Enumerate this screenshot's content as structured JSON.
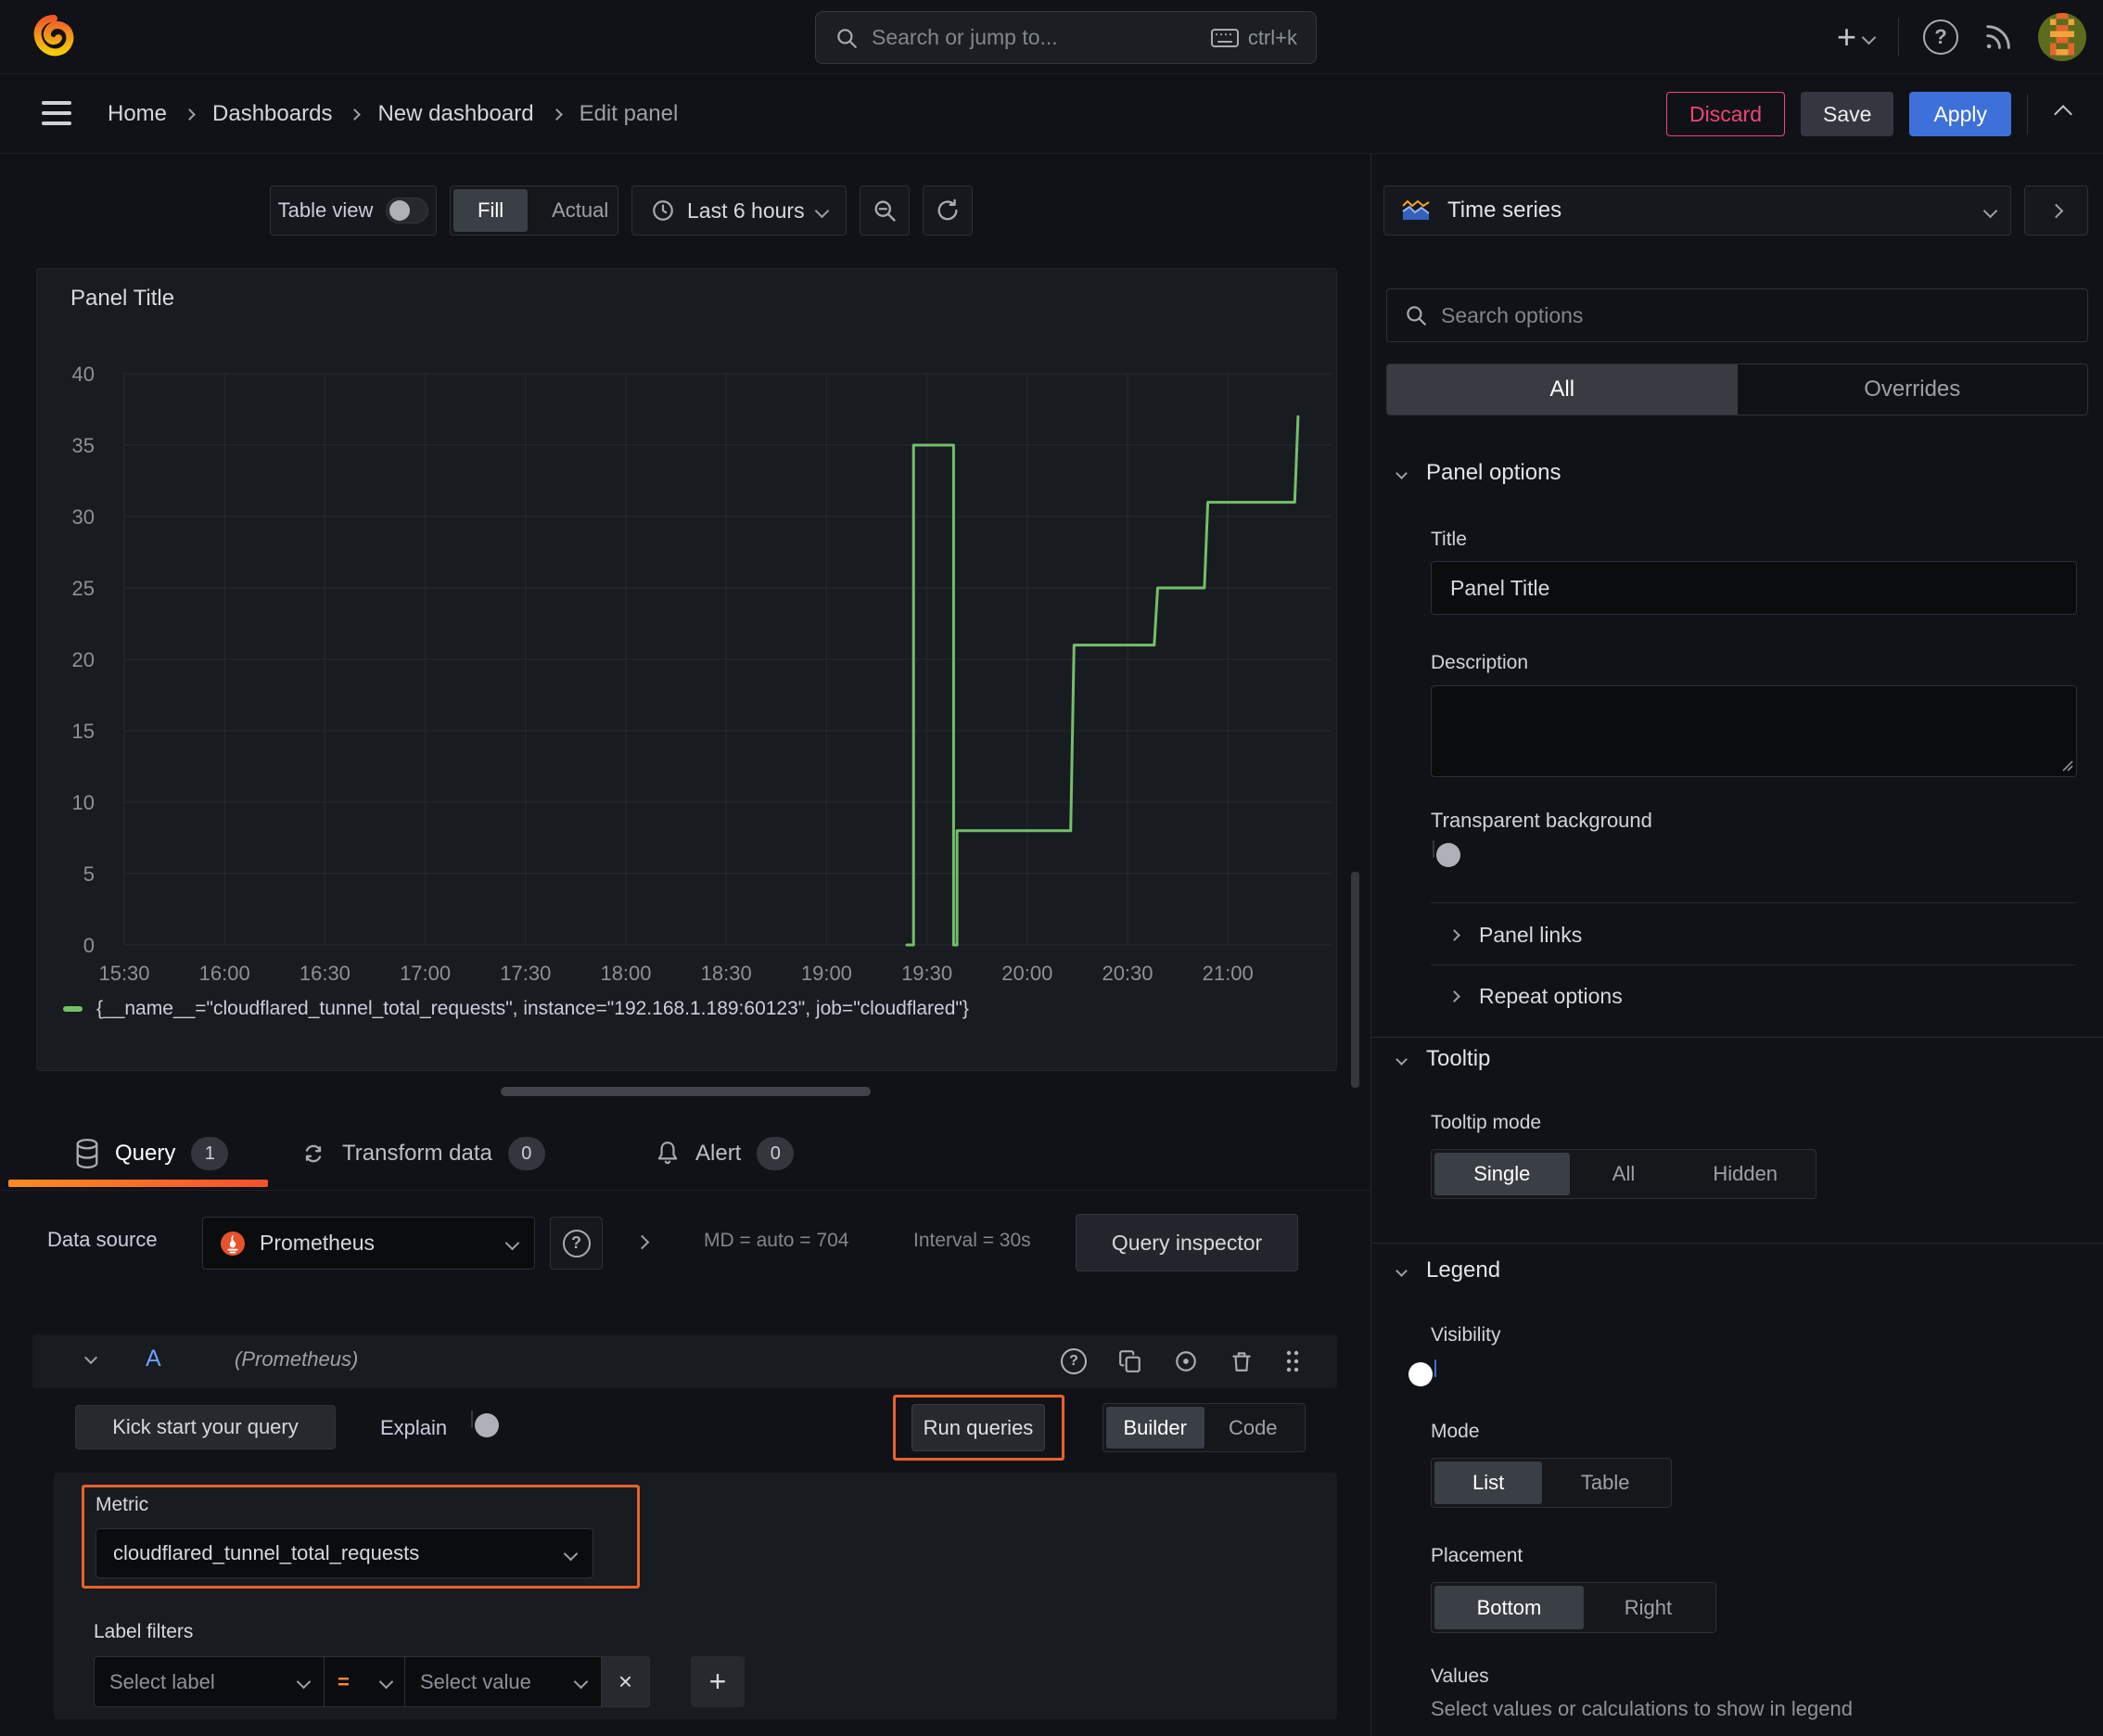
{
  "topnav": {
    "search_placeholder": "Search or jump to...",
    "shortcut": "ctrl+k"
  },
  "breadcrumb": {
    "items": [
      "Home",
      "Dashboards",
      "New dashboard",
      "Edit panel"
    ],
    "discard": "Discard",
    "save": "Save",
    "apply": "Apply"
  },
  "toolbar": {
    "table_view": "Table view",
    "fill": "Fill",
    "actual": "Actual",
    "time_range": "Last 6 hours"
  },
  "panel": {
    "title": "Panel Title"
  },
  "chart_data": {
    "type": "line",
    "title": "Panel Title",
    "xlabel": "",
    "ylabel": "",
    "ylim": [
      0,
      40
    ],
    "y_ticks": [
      0,
      5,
      10,
      15,
      20,
      25,
      30,
      35,
      40
    ],
    "x_ticks": [
      "15:30",
      "16:00",
      "16:30",
      "17:00",
      "17:30",
      "18:00",
      "18:30",
      "19:00",
      "19:30",
      "20:00",
      "20:30",
      "21:00"
    ],
    "x_tick_minutes": [
      930,
      960,
      990,
      1020,
      1050,
      1080,
      1110,
      1140,
      1170,
      1200,
      1230,
      1260
    ],
    "x_domain_minutes": [
      930,
      1291
    ],
    "grid": true,
    "line_color": "#73bf69",
    "legend_position": "bottom",
    "legend": "{__name__=\"cloudflared_tunnel_total_requests\", instance=\"192.168.1.189:60123\", job=\"cloudflared\"}",
    "series": [
      {
        "name": "cloudflared_tunnel_total_requests",
        "points_minutes_value": [
          [
            1164,
            0
          ],
          [
            1166,
            0
          ],
          [
            1166,
            35
          ],
          [
            1178,
            35
          ],
          [
            1178,
            0
          ],
          [
            1179,
            0
          ],
          [
            1179,
            8
          ],
          [
            1213,
            8
          ],
          [
            1214,
            21
          ],
          [
            1238,
            21
          ],
          [
            1239,
            25
          ],
          [
            1253,
            25
          ],
          [
            1254,
            31
          ],
          [
            1280,
            31
          ],
          [
            1281,
            37
          ]
        ]
      }
    ]
  },
  "tabs": {
    "query": "Query",
    "query_count": "1",
    "transform": "Transform data",
    "transform_count": "0",
    "alert": "Alert",
    "alert_count": "0"
  },
  "query_editor": {
    "datasource_label": "Data source",
    "datasource": "Prometheus",
    "md_stat": "MD = auto = 704",
    "interval_stat": "Interval = 30s",
    "inspector": "Query inspector",
    "row_ref": "A",
    "row_ds_hint": "(Prometheus)",
    "kick_start": "Kick start your query",
    "explain": "Explain",
    "run_queries": "Run queries",
    "builder": "Builder",
    "code": "Code",
    "metric_label": "Metric",
    "metric_value": "cloudflared_tunnel_total_requests",
    "label_filters_label": "Label filters",
    "select_label_placeholder": "Select label",
    "operator": "=",
    "select_value_placeholder": "Select value",
    "accent_orange": "#e8612c"
  },
  "sidebar": {
    "viz_type": "Time series",
    "search_placeholder": "Search options",
    "tab_all": "All",
    "tab_overrides": "Overrides",
    "panel_options": {
      "heading": "Panel options",
      "title_label": "Title",
      "title_value": "Panel Title",
      "description_label": "Description",
      "transparent_label": "Transparent background"
    },
    "panel_links": "Panel links",
    "repeat_options": "Repeat options",
    "tooltip": {
      "heading": "Tooltip",
      "mode_label": "Tooltip mode",
      "options": [
        "Single",
        "All",
        "Hidden"
      ],
      "selected": "Single"
    },
    "legend": {
      "heading": "Legend",
      "visibility_label": "Visibility",
      "mode_label": "Mode",
      "mode_options": [
        "List",
        "Table"
      ],
      "mode_selected": "List",
      "placement_label": "Placement",
      "placement_options": [
        "Bottom",
        "Right"
      ],
      "placement_selected": "Bottom",
      "values_label": "Values",
      "values_desc": "Select values or calculations to show in legend"
    },
    "accent_blue": "#3d71d9"
  }
}
